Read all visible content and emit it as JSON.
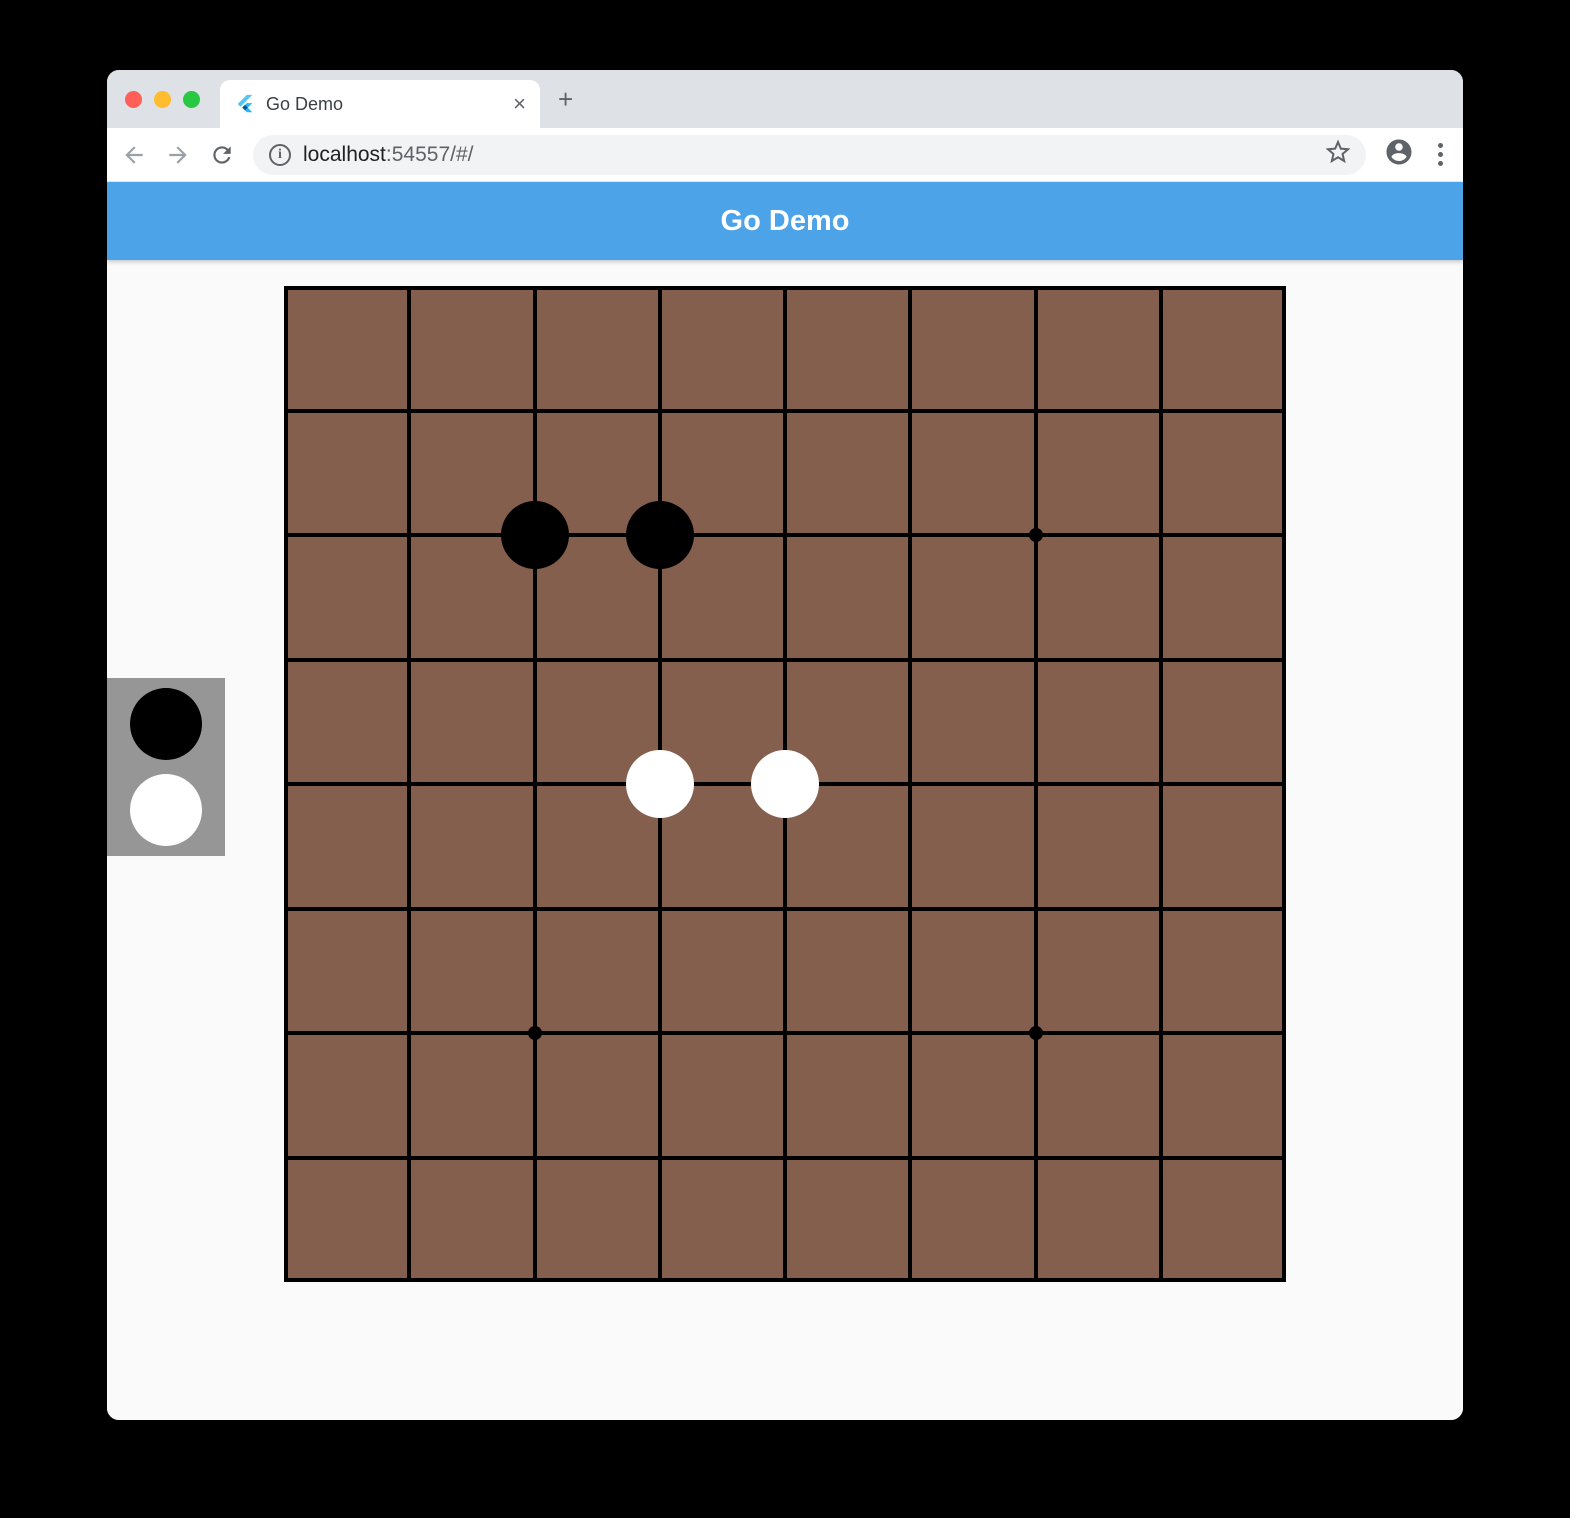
{
  "browser": {
    "tab_title": "Go Demo",
    "url_host": "localhost",
    "url_port": ":54557",
    "url_path": "/#/"
  },
  "app": {
    "title": "Go Demo"
  },
  "board": {
    "size": 9,
    "star_points": [
      {
        "col": 6,
        "row": 2
      },
      {
        "col": 2,
        "row": 6
      },
      {
        "col": 6,
        "row": 6
      }
    ],
    "stones": [
      {
        "col": 2,
        "row": 2,
        "color": "black"
      },
      {
        "col": 3,
        "row": 2,
        "color": "black"
      },
      {
        "col": 3,
        "row": 4,
        "color": "white"
      },
      {
        "col": 4,
        "row": 4,
        "color": "white"
      }
    ]
  },
  "palette": {
    "colors": [
      "black",
      "white"
    ]
  }
}
